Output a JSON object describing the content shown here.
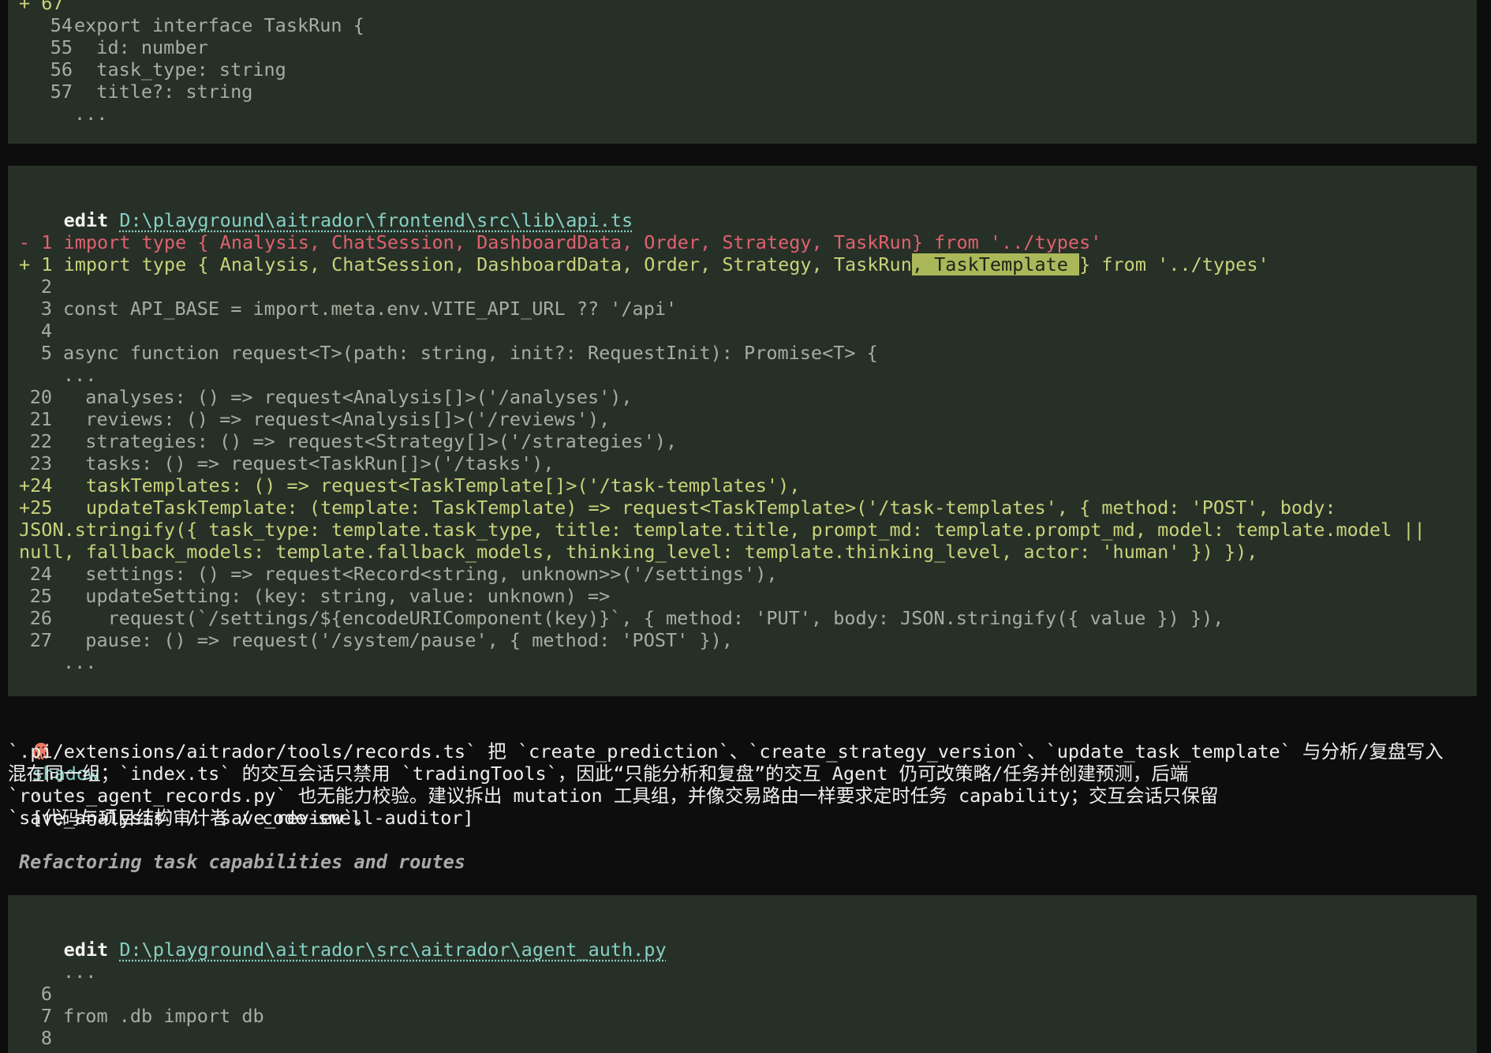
{
  "block1": {
    "lines": [
      {
        "no": "+ 67",
        "code": ""
      },
      {
        "no": "54",
        "code": "export interface TaskRun {"
      },
      {
        "no": "55",
        "code": "  id: number"
      },
      {
        "no": "56",
        "code": "  task_type: string"
      },
      {
        "no": "57",
        "code": "  title?: string"
      },
      {
        "no": "",
        "code": "..."
      }
    ]
  },
  "block2": {
    "edit_label": "edit",
    "path": "D:\\playground\\aitrador\\frontend\\src\\lib\\api.ts",
    "del_line": "- 1 import type { Analysis, ChatSession, DashboardData, Order, Strategy, TaskRun} from '../types'",
    "add_line_pre": "+ 1 import type { Analysis, ChatSession, DashboardData, Order, Strategy, TaskRun",
    "add_line_hl": ", TaskTemplate ",
    "add_line_post": "} from '../types'",
    "lines": [
      {
        "no": "2",
        "code": ""
      },
      {
        "no": "3",
        "code": "const API_BASE = import.meta.env.VITE_API_URL ?? '/api'"
      },
      {
        "no": "4",
        "code": ""
      },
      {
        "no": "5",
        "code": "async function request<T>(path: string, init?: RequestInit): Promise<T> {"
      },
      {
        "no": "",
        "code": "..."
      },
      {
        "no": "20",
        "code": "  analyses: () => request<Analysis[]>('/analyses'),"
      },
      {
        "no": "21",
        "code": "  reviews: () => request<Analysis[]>('/reviews'),"
      },
      {
        "no": "22",
        "code": "  strategies: () => request<Strategy[]>('/strategies'),"
      },
      {
        "no": "23",
        "code": "  tasks: () => request<TaskRun[]>('/tasks'),"
      }
    ],
    "added": [
      "+24   taskTemplates: () => request<TaskTemplate[]>('/task-templates'),",
      "+25   updateTaskTemplate: (template: TaskTemplate) => request<TaskTemplate>('/task-templates', { method: 'POST', body:",
      "JSON.stringify({ task_type: template.task_type, title: template.title, prompt_md: template.prompt_md, model: template.model ||",
      "null, fallback_models: template.fallback_models, thinking_level: template.thinking_level, actor: 'human' }) }),"
    ],
    "tail": [
      {
        "no": "24",
        "code": "  settings: () => request<Record<string, unknown>>('/settings'),"
      },
      {
        "no": "25",
        "code": "  updateSetting: (key: string, value: unknown) =>"
      },
      {
        "no": "26",
        "code": "    request(`/settings/${encodeURIComponent(key)}`, { method: 'PUT', body: JSON.stringify({ value }) }),"
      },
      {
        "no": "27",
        "code": "  pause: () => request('/system/pause', { method: 'POST' }),"
      },
      {
        "no": "",
        "code": "..."
      }
    ]
  },
  "message": {
    "agent": "shadow",
    "separator": "·",
    "role": "[代码与项目结构审计者 / code-smell-auditor]",
    "body": [
      "`.pi/extensions/aitrador/tools/records.ts` 把 `create_prediction`、`create_strategy_version`、`update_task_template` 与分析/复盘写入",
      "混在同一组；`index.ts` 的交互会话只禁用 `tradingTools`，因此“只能分析和复盘”的交互 Agent 仍可改策略/任务并创建预测，后端",
      "`routes_agent_records.py` 也无能力校验。建议拆出 mutation 工具组，并像交易路由一样要求定时任务 capability；交互会话只保留",
      "`save_analysis` / `save_review`。"
    ],
    "status": "Refactoring task capabilities and routes"
  },
  "block3": {
    "edit_label": "edit",
    "path": "D:\\playground\\aitrador\\src\\aitrador\\agent_auth.py",
    "lines": [
      {
        "no": "",
        "code": "..."
      },
      {
        "no": "6",
        "code": ""
      },
      {
        "no": "7",
        "code": "from .db import db"
      },
      {
        "no": "8",
        "code": ""
      }
    ]
  },
  "colors": {
    "panel": "#273027",
    "background": "#0c0d0c",
    "added": "#c9d27a",
    "removed": "#e0616f",
    "path": "#85d0c4",
    "highlight": "#aab85a"
  },
  "icons": {
    "agent": "octopus-icon"
  }
}
